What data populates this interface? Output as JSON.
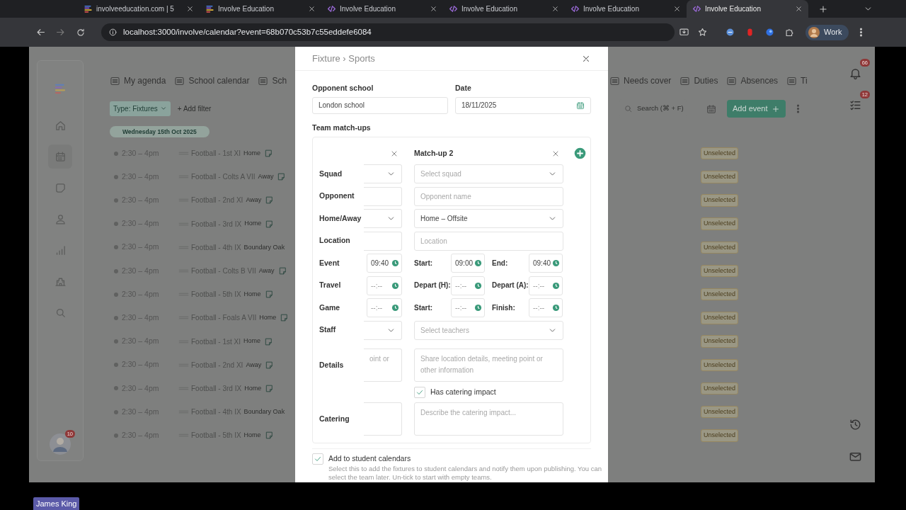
{
  "browser": {
    "tabs": [
      {
        "title": "involveeducation.com | 5",
        "kind": "stack",
        "selected": false
      },
      {
        "title": "Involve Education",
        "kind": "stack",
        "selected": false
      },
      {
        "title": "Involve Education",
        "kind": "code",
        "selected": false
      },
      {
        "title": "Involve Education",
        "kind": "code",
        "selected": false
      },
      {
        "title": "Involve Education",
        "kind": "code",
        "selected": false
      },
      {
        "title": "Involve Education",
        "kind": "code",
        "selected": true
      }
    ],
    "url": "localhost:3000/involve/calendar?event=68b070c53b7c55eddefe6084",
    "profile": "Work"
  },
  "app": {
    "nav_left": [
      "My agenda",
      "School calendar",
      "Sch"
    ],
    "nav_right": [
      "Needs cover",
      "Duties",
      "Absences",
      "Ti"
    ],
    "filter": "Type: Fixtures",
    "add_filter": "+ Add filter",
    "date": "Wednesday 15th Oct 2025",
    "search_placeholder": "Search (⌘ + F)",
    "add_event": "Add event",
    "notifications": "66",
    "tasks": "12",
    "avatar_badge": "10",
    "events": [
      {
        "time": "2:30 – 4pm",
        "title": "Football - 1st XI",
        "venue": "Home",
        "note": true,
        "status": "Unselected"
      },
      {
        "time": "2:30 – 4pm",
        "title": "Football - Colts A VII",
        "venue": "Away",
        "note": true,
        "status": "Unselected"
      },
      {
        "time": "2:30 – 4pm",
        "title": "Football - 2nd XI",
        "venue": "Away",
        "note": true,
        "status": "Unselected"
      },
      {
        "time": "2:30 – 4pm",
        "title": "Football - 3rd IX",
        "venue": "Home",
        "note": true,
        "status": "Unselected"
      },
      {
        "time": "2:30 – 4pm",
        "title": "Football - 4th IX",
        "venue": "Boundary Oak",
        "note": false,
        "status": "Unselected"
      },
      {
        "time": "2:30 – 4pm",
        "title": "Football - Colts B VII",
        "venue": "Away",
        "note": true,
        "status": "Unselected"
      },
      {
        "time": "2:30 – 4pm",
        "title": "Football - 5th IX",
        "venue": "Home",
        "note": true,
        "status": "Unselected"
      },
      {
        "time": "2:30 – 4pm",
        "title": "Football - Foals A VII",
        "venue": "Home",
        "note": true,
        "status": "Unselected"
      },
      {
        "time": "2:30 – 4pm",
        "title": "Football - 1st XI",
        "venue": "Home",
        "note": true,
        "status": "Unselected"
      },
      {
        "time": "2:30 – 4pm",
        "title": "Football - 2nd XI",
        "venue": "Away",
        "note": true,
        "status": "Unselected"
      },
      {
        "time": "2:30 – 4pm",
        "title": "Football - 3rd IX",
        "venue": "Home",
        "note": true,
        "status": "Unselected"
      },
      {
        "time": "2:30 – 4pm",
        "title": "Football - 4th IX",
        "venue": "Boundary Oak",
        "note": false,
        "status": "Unselected"
      },
      {
        "time": "2:30 – 4pm",
        "title": "Football - 5th IX",
        "venue": "Home",
        "note": true,
        "status": "Unselected"
      }
    ]
  },
  "modal": {
    "title": "Fixture › Sports",
    "opponent_school": {
      "label": "Opponent school",
      "value": "London school"
    },
    "date": {
      "label": "Date",
      "value": "18/11/2025"
    },
    "matchups_label": "Team match-ups",
    "matchups": [
      {
        "removable": true
      },
      {
        "title": "Match-up 2",
        "removable": true
      }
    ],
    "rows": [
      {
        "label": "Squad",
        "cells": [
          {
            "kind": "select"
          },
          {
            "kind": "select",
            "placeholder": "Select squad"
          }
        ]
      },
      {
        "label": "Opponent",
        "cells": [
          {
            "kind": "input"
          },
          {
            "kind": "input",
            "placeholder": "Opponent name"
          }
        ]
      },
      {
        "label": "Home/Away",
        "cells": [
          {
            "kind": "select"
          },
          {
            "kind": "select",
            "value": "Home – Offsite"
          }
        ]
      },
      {
        "label": "Location",
        "cells": [
          {
            "kind": "input"
          },
          {
            "kind": "input",
            "placeholder": "Location"
          }
        ]
      },
      {
        "label": "Event",
        "cells": [
          {
            "kind": "times",
            "times": [
              {
                "value": "09:40"
              }
            ]
          },
          {
            "kind": "times",
            "times": [
              {
                "label": "Start:",
                "value": "09:00"
              },
              {
                "label": "End:",
                "value": "09:40"
              }
            ]
          }
        ]
      },
      {
        "label": "Travel",
        "cells": [
          {
            "kind": "times",
            "times": [
              {
                "placeholder": "--:--"
              }
            ]
          },
          {
            "kind": "times",
            "times": [
              {
                "label": "Depart (H):",
                "placeholder": "--:--"
              },
              {
                "label": "Depart (A):",
                "placeholder": "--:--"
              }
            ]
          }
        ]
      },
      {
        "label": "Game",
        "cells": [
          {
            "kind": "times",
            "times": [
              {
                "placeholder": "--:--"
              }
            ]
          },
          {
            "kind": "times",
            "times": [
              {
                "label": "Start:",
                "placeholder": "--:--"
              },
              {
                "label": "Finish:",
                "placeholder": "--:--"
              }
            ]
          }
        ]
      },
      {
        "label": "Staff",
        "cells": [
          {
            "kind": "select"
          },
          {
            "kind": "select",
            "placeholder": "Select teachers"
          }
        ]
      },
      {
        "label": "Details",
        "cells": [
          {
            "kind": "textarea",
            "placeholder": "oint or"
          },
          {
            "kind": "textarea",
            "placeholder": "Share location details, meeting point or other information"
          }
        ]
      },
      {
        "cells": [
          {
            "kind": "blank"
          },
          {
            "kind": "check",
            "label": "Has catering impact",
            "checked": true
          }
        ]
      },
      {
        "label": "Catering",
        "cells": [
          {
            "kind": "textarea"
          },
          {
            "kind": "textarea",
            "placeholder": "Describe the catering impact..."
          }
        ]
      }
    ],
    "add_to_calendars": {
      "label": "Add to student calendars",
      "checked": true,
      "help": "Select this to add the fixtures to student calendars and notify them upon publishing. You can select the team later. Un-tick to start with empty teams."
    }
  },
  "presenter": "James King"
}
